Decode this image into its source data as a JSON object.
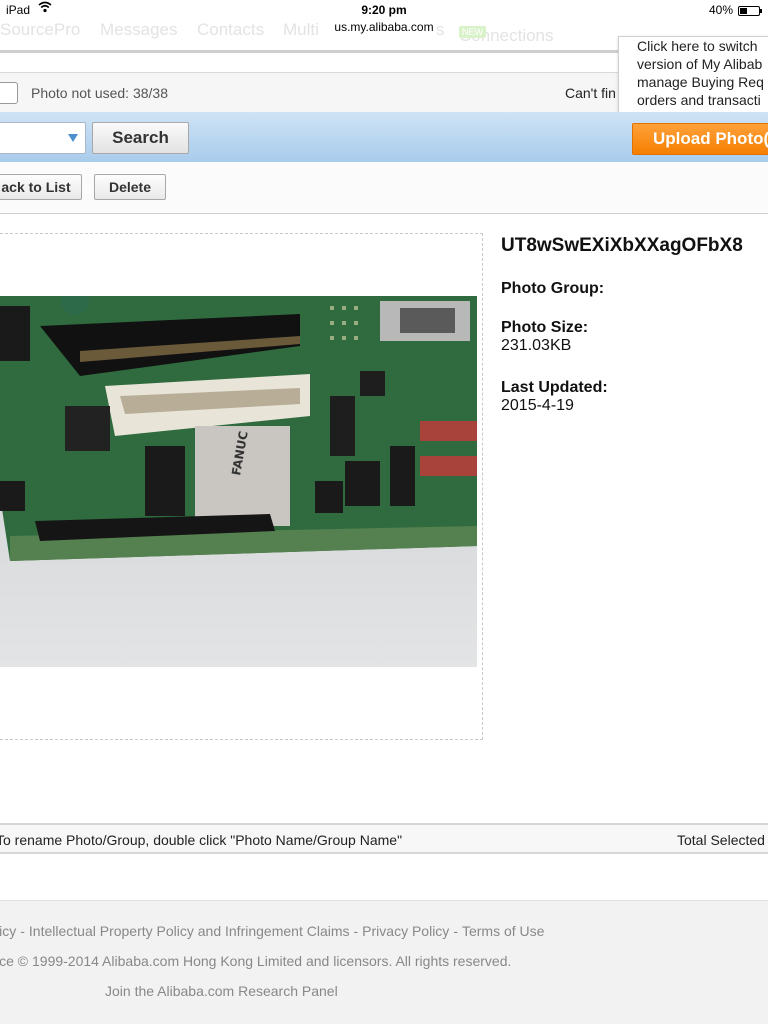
{
  "status_bar": {
    "device": "iPad",
    "time": "9:20 pm",
    "battery": "40%",
    "url": "us.my.alibaba.com"
  },
  "top_nav": {
    "items": [
      "SourcePro",
      "Messages",
      "Contacts",
      "Multi",
      "s",
      "Connections"
    ],
    "new_badge": "NEW"
  },
  "popup": {
    "lines": [
      "Click here to switch",
      "version of My Alibab",
      "manage Buying Req",
      "orders and transacti"
    ]
  },
  "info_row": {
    "photo_not_used": "Photo not used: 38/38",
    "cant_find": "Can't fin"
  },
  "search_bar": {
    "search_label": "Search",
    "upload_label": "Upload Photo("
  },
  "actions": {
    "back_label": "ack to List",
    "delete_label": "Delete"
  },
  "details": {
    "photo_name": "UT8wSwEXiXbXXagOFbX8",
    "photo_group_label": "Photo Group:",
    "photo_size_label": "Photo Size:",
    "photo_size_value": "231.03KB",
    "last_updated_label": "Last Updated:",
    "last_updated_value": "2015-4-19"
  },
  "hint_bar": {
    "hint": "To rename Photo/Group, double click \"Photo Name/Group Name\"",
    "total": "Total Selected"
  },
  "footer": {
    "links": [
      "licy",
      "Intellectual Property Policy and Infringement Claims",
      "Privacy Policy",
      "Terms of Use"
    ],
    "separator": "-",
    "copyright": "ice © 1999-2014 Alibaba.com Hong Kong Limited and licensors. All rights reserved.",
    "research_panel": "Join the Alibaba.com Research Panel"
  }
}
